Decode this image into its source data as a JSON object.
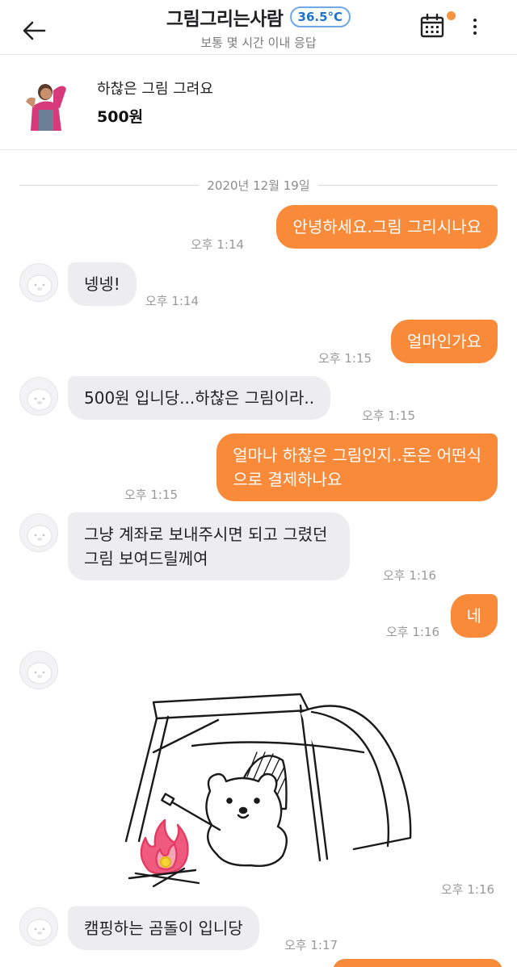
{
  "header": {
    "title": "그림그리는사람",
    "temperature": "36.5°C",
    "subtitle": "보통 몇 시간 이내 응답",
    "icons": [
      "back-arrow-icon",
      "calendar-icon",
      "more-vertical-icon"
    ]
  },
  "product": {
    "title": "하찮은 그림 그려요",
    "price": "500원"
  },
  "date_separator": "2020년 12월 19일",
  "messages": [
    {
      "from": "me",
      "text": "안녕하세요.그림 그리시나요",
      "time": "오후 1:14"
    },
    {
      "from": "them",
      "text": "넹넹!",
      "time": "오후 1:14"
    },
    {
      "from": "me",
      "text": "얼마인가요",
      "time": "오후 1:15"
    },
    {
      "from": "them",
      "text": "500원 입니당...하찮은 그림이라..",
      "time": "오후 1:15"
    },
    {
      "from": "me",
      "lines": [
        "얼마나 하찮은 그림인지..돈은 어떤식",
        "으로 결제하나요"
      ],
      "time": "오후 1:15"
    },
    {
      "from": "them",
      "lines": [
        "그냥 계좌로 보내주시면 되고 그렸던",
        "그림 보여드릴께여"
      ],
      "time": "오후 1:16"
    },
    {
      "from": "me",
      "text": "네",
      "time": "오후 1:16"
    },
    {
      "from": "them",
      "type": "image",
      "image": "bear-camping-sticker",
      "time": "오후 1:16"
    },
    {
      "from": "them",
      "text": "캠핑하는 곰돌이 입니당",
      "time": "오후 1:17"
    }
  ],
  "colors": {
    "accent": "#f98a3a",
    "their_bubble": "#ededf0",
    "temperature": "#1f72c9"
  }
}
